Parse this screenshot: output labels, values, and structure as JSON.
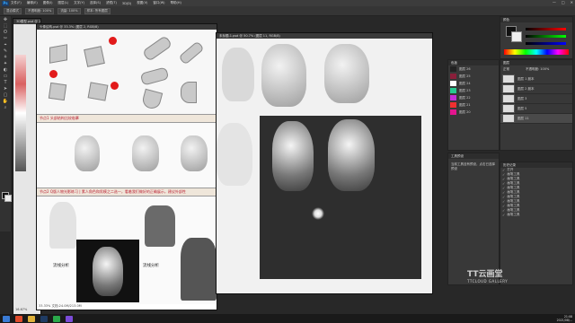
{
  "app": {
    "logo": "Ps"
  },
  "menubar": {
    "items": [
      "文件(F)",
      "编辑(E)",
      "图像(I)",
      "图层(L)",
      "文字(Y)",
      "选择(S)",
      "滤镜(T)",
      "3D(D)",
      "视图(V)",
      "窗口(W)",
      "帮助(H)"
    ]
  },
  "window_controls": {
    "minimize": "—",
    "maximize": "□",
    "close": "✕"
  },
  "optbar": {
    "mode": "混合模式",
    "opacity": "不透明度: 100%",
    "flow": "流量: 100%",
    "sample": "样本: 所有图层"
  },
  "tools": [
    "✥",
    "⬚",
    "ʘ",
    "✂",
    "⌖",
    "✎",
    "⚘",
    "✦",
    "◐",
    "▭",
    "T",
    "➤",
    "▢",
    "✋",
    "⌕"
  ],
  "docs": {
    "left_tab": "3D模型.psd @ 16.7% (图层 1, RGB/8)",
    "mid_tab": "头像结构.psd @ 33.3% (图层 2, RGB/8)",
    "right_tab": "未标题-1.psd @ 50.7% (图层 11, RGB/8)"
  },
  "lesson": {
    "label1": "节点1 头部结构比较临摹",
    "label2": "节点2 Q版人物光影练习 | 素人角色和男模之二选一，看着我们做好的正确展示，建议外部性",
    "caption_left": "流线分析",
    "caption_right": "流线分析"
  },
  "status": {
    "zoom_left": "16.67%",
    "doc_left": "文档:18.6M/102.0M",
    "zoom_mid": "33.33%",
    "doc_mid": "文档:24.0M/213.0M"
  },
  "swatches": {
    "title": "色板",
    "items": [
      {
        "name": "图层 26",
        "color": "#222222"
      },
      {
        "name": "图层 25",
        "color": "#8a1f3a"
      },
      {
        "name": "图层 24",
        "color": "#ffffff"
      },
      {
        "name": "图层 23",
        "color": "#26c98f"
      },
      {
        "name": "图层 22",
        "color": "#c42dd8"
      },
      {
        "name": "图层 21",
        "color": "#f03030"
      },
      {
        "name": "图层 20",
        "color": "#e3158e"
      }
    ]
  },
  "color_panel": {
    "title": "颜色"
  },
  "layers": {
    "title": "图层",
    "kind": "正常",
    "opacity": "不透明度: 100%",
    "items": [
      {
        "name": "图层 1 副本"
      },
      {
        "name": "图层 2 副本"
      },
      {
        "name": "图层 3"
      },
      {
        "name": "图层 5"
      },
      {
        "name": "图层 11"
      }
    ]
  },
  "properties": {
    "title": "工具预设",
    "text": "当前工具没有预设，点击已选择预设"
  },
  "history": {
    "title": "历史记录",
    "items": [
      "打开",
      "画笔工具",
      "画笔工具",
      "画笔工具",
      "画笔工具",
      "画笔工具",
      "画笔工具",
      "画笔工具",
      "画笔工具",
      "画笔工具",
      "画笔工具"
    ]
  },
  "watermark": {
    "name": "TT云画堂",
    "sub": "TTCLOUD GALLERY"
  },
  "taskbar": {
    "time": "21:08",
    "date": "2021/08/..."
  },
  "colors": {
    "accent": "#31a8ff",
    "label_red": "#b22233",
    "dot_red": "#e21b1b"
  }
}
